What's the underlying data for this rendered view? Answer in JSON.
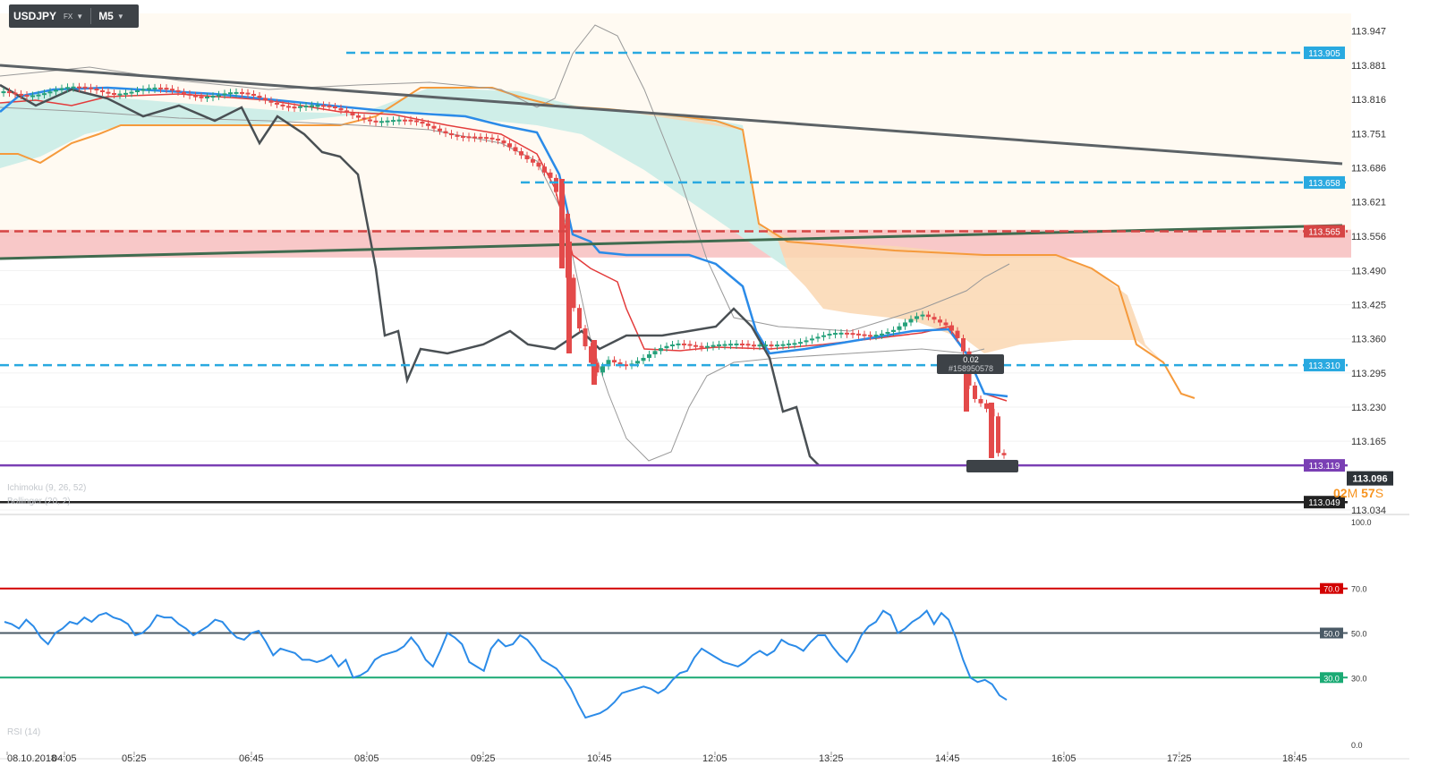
{
  "toolbar": {
    "symbol": "USDJPY",
    "market": "FX",
    "timeframe": "M5"
  },
  "colors": {
    "up": "#26a17b",
    "down": "#e34a4a",
    "cloud_bull": "#cfeee8",
    "cloud_bear": "#fad7b1",
    "axis_text": "#333333"
  },
  "indicator_labels": {
    "ichimoku": "Ichimoku (9, 26, 52)",
    "bollinger": "Bollinger (20, 2)",
    "rsi": "RSI (14)"
  },
  "countdown": {
    "minutes": "02",
    "m_label": "M",
    "seconds": "57",
    "s_label": "S"
  },
  "tooltip": {
    "value": "0.02",
    "id": "#158950578"
  },
  "chart_data": [
    {
      "type": "candlestick",
      "symbol": "USDJPY",
      "timeframe": "M5",
      "ylim": [
        113.034,
        113.98
      ],
      "y_ticks": [
        "113.947",
        "113.881",
        "113.816",
        "113.751",
        "113.686",
        "113.621",
        "113.556",
        "113.490",
        "113.425",
        "113.360",
        "113.295",
        "113.230",
        "113.165",
        "113.034"
      ],
      "x_ticks": [
        "08.10.2018",
        "04:05",
        "05:25",
        "06:45",
        "08:05",
        "09:25",
        "10:45",
        "12:05",
        "13:25",
        "14:45",
        "16:05",
        "17:25",
        "18:45"
      ],
      "levels": [
        {
          "value": 113.905,
          "label": "113.905",
          "color": "#29a9e0",
          "style": "dashed"
        },
        {
          "value": 113.658,
          "label": "113.658",
          "color": "#29a9e0",
          "style": "dashed"
        },
        {
          "value": 113.565,
          "label": "113.565",
          "color": "#d64545",
          "style": "dashed"
        },
        {
          "value": 113.31,
          "label": "113.310",
          "color": "#29a9e0",
          "style": "dashed"
        },
        {
          "value": 113.119,
          "label": "113.119",
          "color": "#7a3fb4",
          "style": "solid"
        },
        {
          "value": 113.049,
          "label": "113.049",
          "color": "#222222",
          "style": "solid"
        }
      ],
      "resistance_zone": [
        113.515,
        113.568
      ],
      "current_price": 113.096,
      "current_price_label": "113.096",
      "indicators": [
        "Ichimoku (9, 26, 52)",
        "Bollinger (20, 2)"
      ]
    },
    {
      "type": "line",
      "title": "RSI (14)",
      "ylim": [
        0,
        100
      ],
      "y_ticks": [
        "100.0",
        "70.0",
        "50.0",
        "30.0",
        "0.0"
      ],
      "levels": [
        {
          "value": 70,
          "label": "70.0",
          "color": "#d20000"
        },
        {
          "value": 50,
          "label": "50.0",
          "color": "#4a5a66"
        },
        {
          "value": 30,
          "label": "30.0",
          "color": "#1aaa74"
        }
      ],
      "series": [
        {
          "values": [
            55,
            54,
            52,
            56,
            53,
            48,
            45,
            50,
            52,
            55,
            54,
            57,
            55,
            58,
            59,
            57,
            56,
            54,
            49,
            50,
            53,
            58,
            57,
            57,
            54,
            52,
            49,
            51,
            53,
            56,
            55,
            51,
            48,
            47,
            50,
            51,
            46,
            40,
            43,
            42,
            41,
            38,
            38,
            37,
            38,
            40,
            35,
            38,
            30,
            31,
            33,
            38,
            40,
            41,
            42,
            44,
            48,
            44,
            38,
            35,
            42,
            50,
            48,
            45,
            37,
            35,
            33,
            43,
            47,
            44,
            45,
            49,
            47,
            43,
            38,
            36,
            34,
            30,
            25,
            18,
            12,
            13,
            14,
            16,
            19,
            23,
            24,
            25,
            26,
            25,
            23,
            25,
            29,
            32,
            33,
            39,
            43,
            41,
            39,
            37,
            36,
            35,
            37,
            40,
            42,
            40,
            42,
            47,
            45,
            44,
            42,
            46,
            49,
            49,
            44,
            40,
            37,
            42,
            49,
            53,
            55,
            60,
            58,
            50,
            52,
            55,
            57,
            60,
            54,
            59,
            56,
            48,
            38,
            30,
            28,
            29,
            27,
            22,
            20
          ]
        }
      ]
    }
  ]
}
